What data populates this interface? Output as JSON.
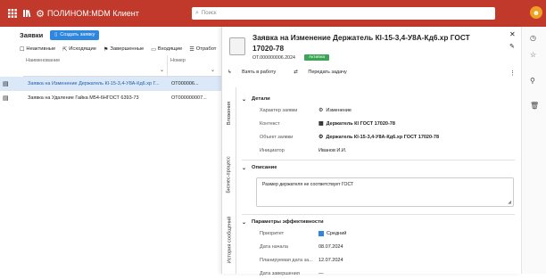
{
  "app": {
    "title": "ПОЛИНОМ:MDM Клиент"
  },
  "search": {
    "placeholder": "Поиск"
  },
  "colors": {
    "topbar": "#c0392b",
    "accent": "#2e86de",
    "status_green": "#3aa655",
    "selected_row": "#dbe8f7",
    "avatar": "#f0a020"
  },
  "icons": {
    "grid": "grid-icon",
    "library": "library-icon",
    "logo": "gear-icon",
    "search": "search-icon",
    "user": "user-avatar-icon",
    "clock": "clock-icon",
    "star": "star-icon",
    "pin": "pin-icon",
    "trash": "trash-icon"
  },
  "left": {
    "title": "Заявки",
    "create_button": "Создать заявку",
    "tabs": [
      {
        "icon": "☐",
        "label": "Неактивные"
      },
      {
        "icon": "⇱",
        "label": "Исходящие"
      },
      {
        "icon": "⚑",
        "label": "Завершенные"
      },
      {
        "icon": "▭",
        "label": "Входящие"
      },
      {
        "icon": "☰",
        "label": "Отработ"
      }
    ],
    "columns": [
      "Наименование",
      "Номер"
    ],
    "rows": [
      {
        "icon": "▤",
        "name": "Заявка на Изменение Держатель Кl-15-3,4-У8А-Кд6.хр Г...",
        "number": "ОТ000006..."
      },
      {
        "icon": "▤",
        "name": "Заявка на Удаление Гайка M54-6НГОСТ 6393-73",
        "number": "ОТ000000007..."
      }
    ]
  },
  "detail": {
    "title": "Заявка на Изменение Держатель Кl-15-3,4-У8А-Кд6.хр ГОСТ 17020-78",
    "code": "ОТ.000000006.2024",
    "status": "Активна",
    "actions": {
      "take": "Взять в работу",
      "transfer": "Передать задачу"
    },
    "vtabs": [
      "Вложения",
      "Бизнес-процесс",
      "История сообщений"
    ],
    "details": {
      "title": "Детали",
      "fields": [
        {
          "label": "Характер заявки",
          "icon": "⚙",
          "value": "Изменение",
          "bold": false
        },
        {
          "label": "Контекст",
          "icon": "▦",
          "value": "Держатель Кl ГОСТ 17020-78",
          "bold": true
        },
        {
          "label": "Объект заявки",
          "icon": "⚙",
          "value": "Держатель Кl-15-3,4-У8А-Кд6.хр ГОСТ 17020-78",
          "bold": true
        },
        {
          "label": "Инициатор",
          "icon": "",
          "value": "Иванов И.И.",
          "bold": false
        }
      ]
    },
    "description": {
      "title": "Описание",
      "text": "Размер держателя не соответствует ГОСТ"
    },
    "efficiency": {
      "title": "Параметры эффективности",
      "fields": [
        {
          "label": "Приоритет",
          "value": "Средний"
        },
        {
          "label": "Дата начала",
          "value": "08.07.2024"
        },
        {
          "label": "Планируемая дата за...",
          "value": "12.07.2024"
        },
        {
          "label": "Дата завершения",
          "value": "—"
        }
      ]
    }
  }
}
